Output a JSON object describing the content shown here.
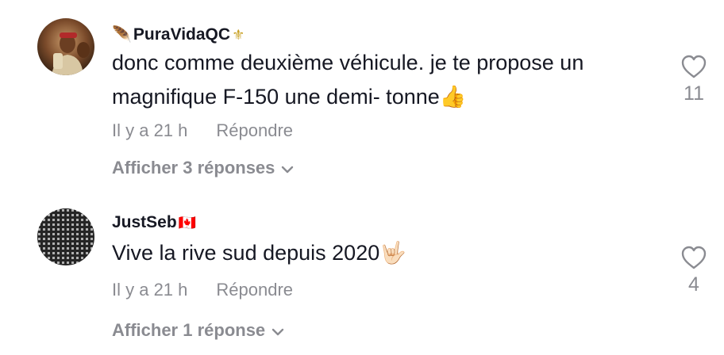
{
  "comments": [
    {
      "username": "PuraVidaQC",
      "name_prefix_emoji": "🪶",
      "name_suffix_emoji": "⚜",
      "text": "donc comme deuxième véhicule. je te propose un magnifique F-150 une demi- tonne👍",
      "time": "Il y a 21 h",
      "reply_label": "Répondre",
      "view_replies_label": "Afficher 3 réponses",
      "likes": "11"
    },
    {
      "username": "JustSeb",
      "name_prefix_emoji": "",
      "name_suffix_emoji": "🇨🇦",
      "text": "Vive la rive sud depuis 2020🤟🏻",
      "time": "Il y a 21 h",
      "reply_label": "Répondre",
      "view_replies_label": "Afficher 1 réponse",
      "likes": "4"
    }
  ],
  "colors": {
    "primary_text": "#161823",
    "secondary_text": "#8a8b91"
  },
  "icons": {
    "like": "heart-outline-icon",
    "expand": "chevron-down-icon"
  }
}
